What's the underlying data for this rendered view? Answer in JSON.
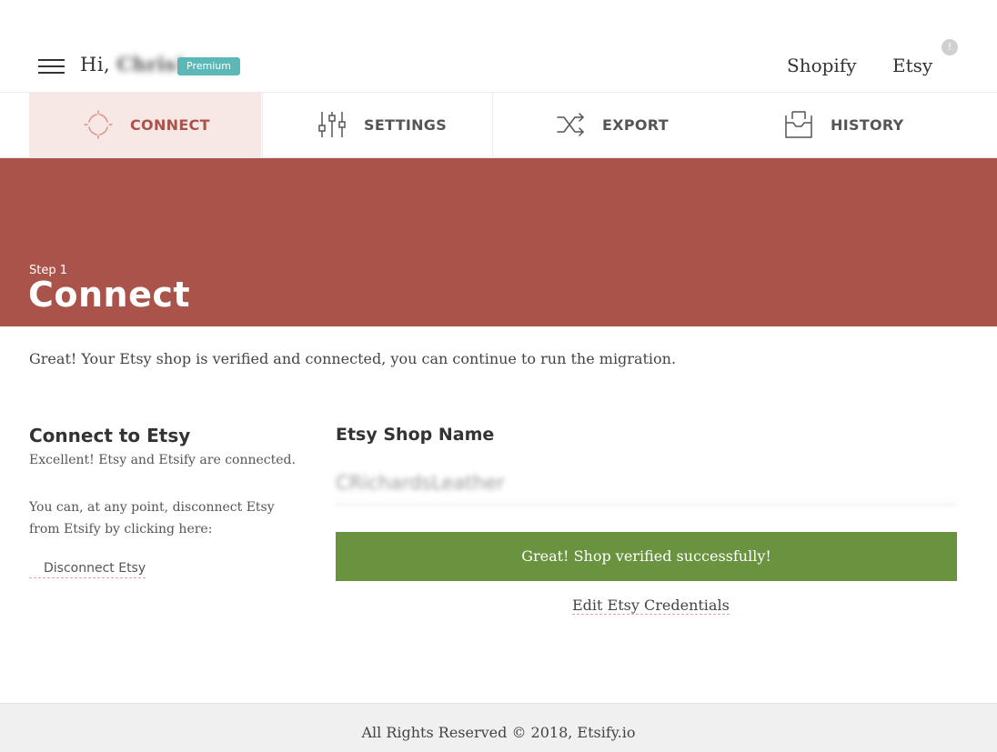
{
  "header": {
    "greeting_prefix": "Hi,",
    "user_name": "Chris!",
    "plan_badge": "Premium",
    "platforms": [
      "Shopify",
      "Etsy"
    ],
    "alert_indicator": "!"
  },
  "tabs": [
    {
      "label": "CONNECT",
      "icon": "connect-icon",
      "active": true
    },
    {
      "label": "SETTINGS",
      "icon": "sliders-icon",
      "active": false
    },
    {
      "label": "EXPORT",
      "icon": "shuffle-icon",
      "active": false
    },
    {
      "label": "HISTORY",
      "icon": "inbox-icon",
      "active": false
    }
  ],
  "hero": {
    "step": "Step 1",
    "title": "Connect"
  },
  "intro": "Great! Your Etsy shop is verified and connected, you can continue to run the migration.",
  "connect_panel": {
    "heading": "Connect to Etsy",
    "status_text": "Excellent! Etsy and Etsify are connected.",
    "instructions": "You can, at any point, disconnect Etsy from Etsify by clicking here:",
    "disconnect_label": "Disconnect Etsy"
  },
  "shop_panel": {
    "heading": "Etsy Shop Name",
    "shop_name_value": "CRichardsLeather",
    "verified_message": "Great! Shop verified successfully!",
    "edit_label": "Edit Etsy Credentials"
  },
  "footer": {
    "text": "All Rights Reserved © 2018, Etsify.io"
  },
  "colors": {
    "brand": "#a9534a",
    "active_tab_bg": "#f7e8e6",
    "success": "#6a9340",
    "badge": "#5cb8b6"
  }
}
